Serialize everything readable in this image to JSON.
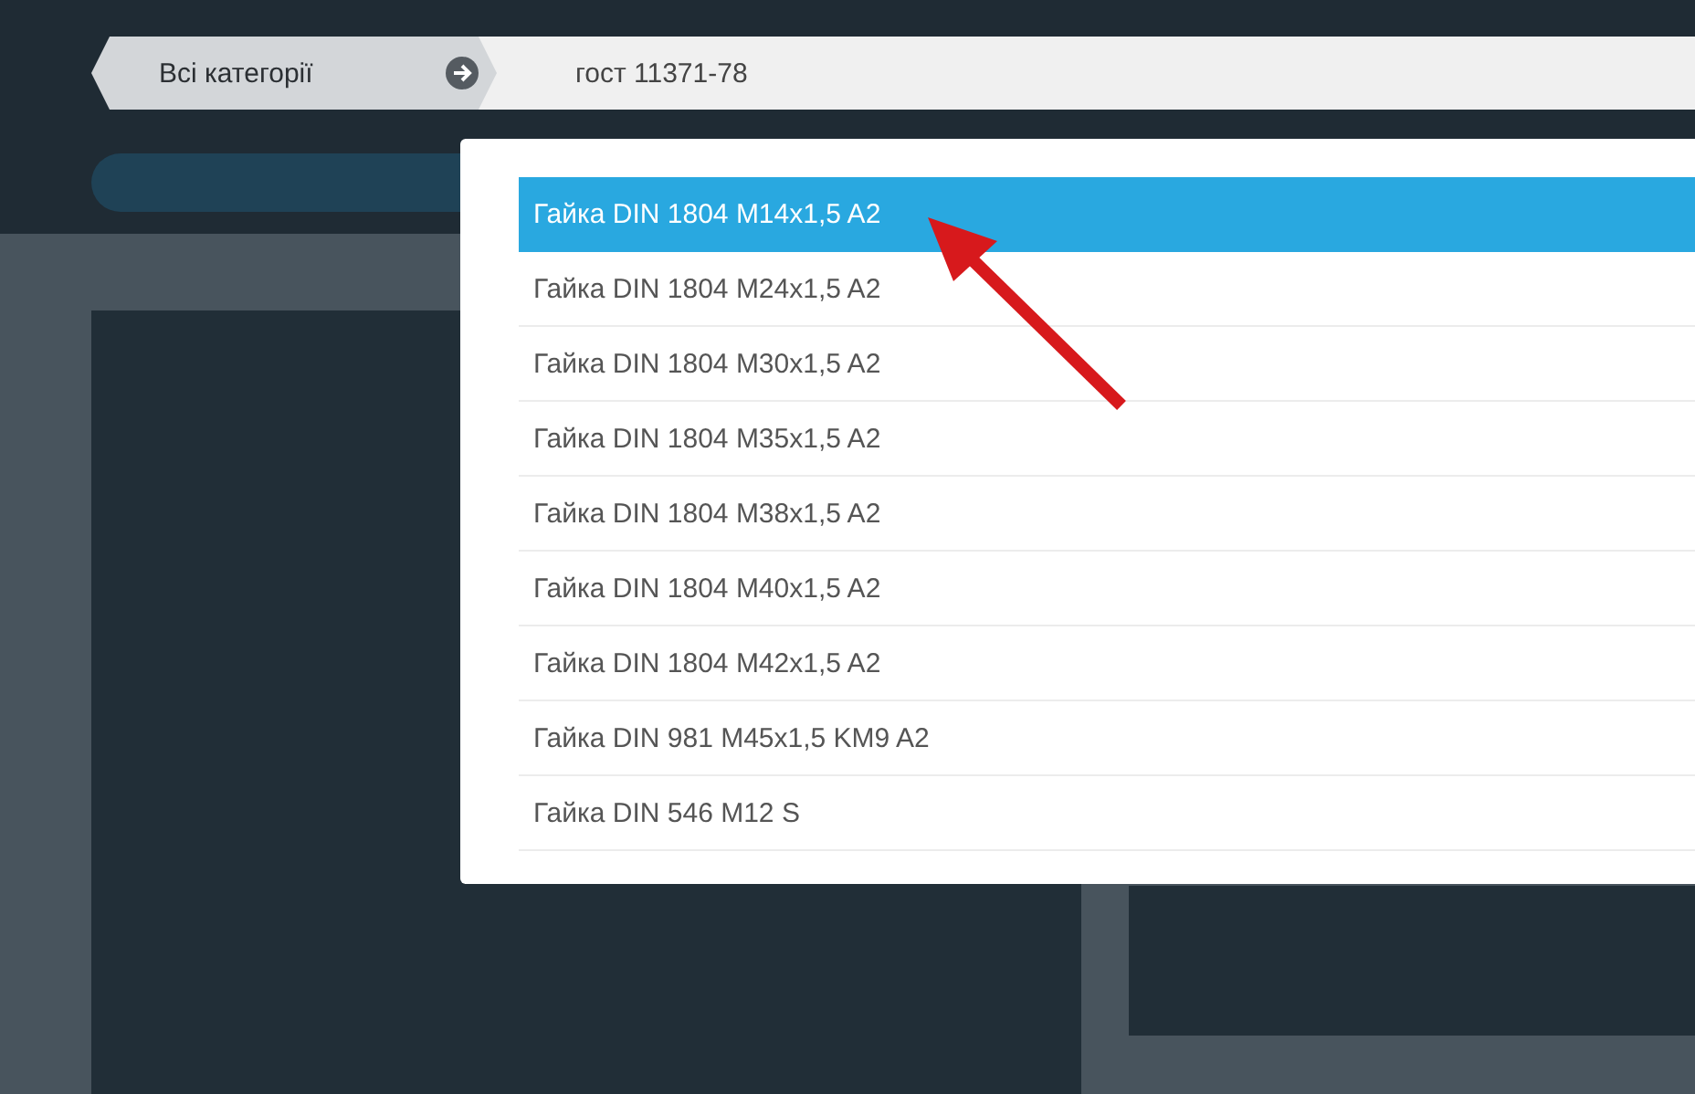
{
  "search": {
    "category": "Всі категорії",
    "query": "гост 11371-78"
  },
  "suggestions": [
    {
      "label": "Гайка DIN 1804 M14x1,5 A2",
      "selected": true
    },
    {
      "label": "Гайка DIN 1804 M24x1,5 A2",
      "selected": false
    },
    {
      "label": "Гайка DIN 1804 M30x1,5 A2",
      "selected": false
    },
    {
      "label": "Гайка DIN 1804 M35x1,5 A2",
      "selected": false
    },
    {
      "label": "Гайка DIN 1804 M38x1,5 A2",
      "selected": false
    },
    {
      "label": "Гайка DIN 1804 M40x1,5 A2",
      "selected": false
    },
    {
      "label": "Гайка DIN 1804 M42x1,5 A2",
      "selected": false
    },
    {
      "label": "Гайка DIN 981 M45x1,5 KM9 A2",
      "selected": false
    },
    {
      "label": "Гайка DIN 546 M12 S",
      "selected": false
    }
  ]
}
